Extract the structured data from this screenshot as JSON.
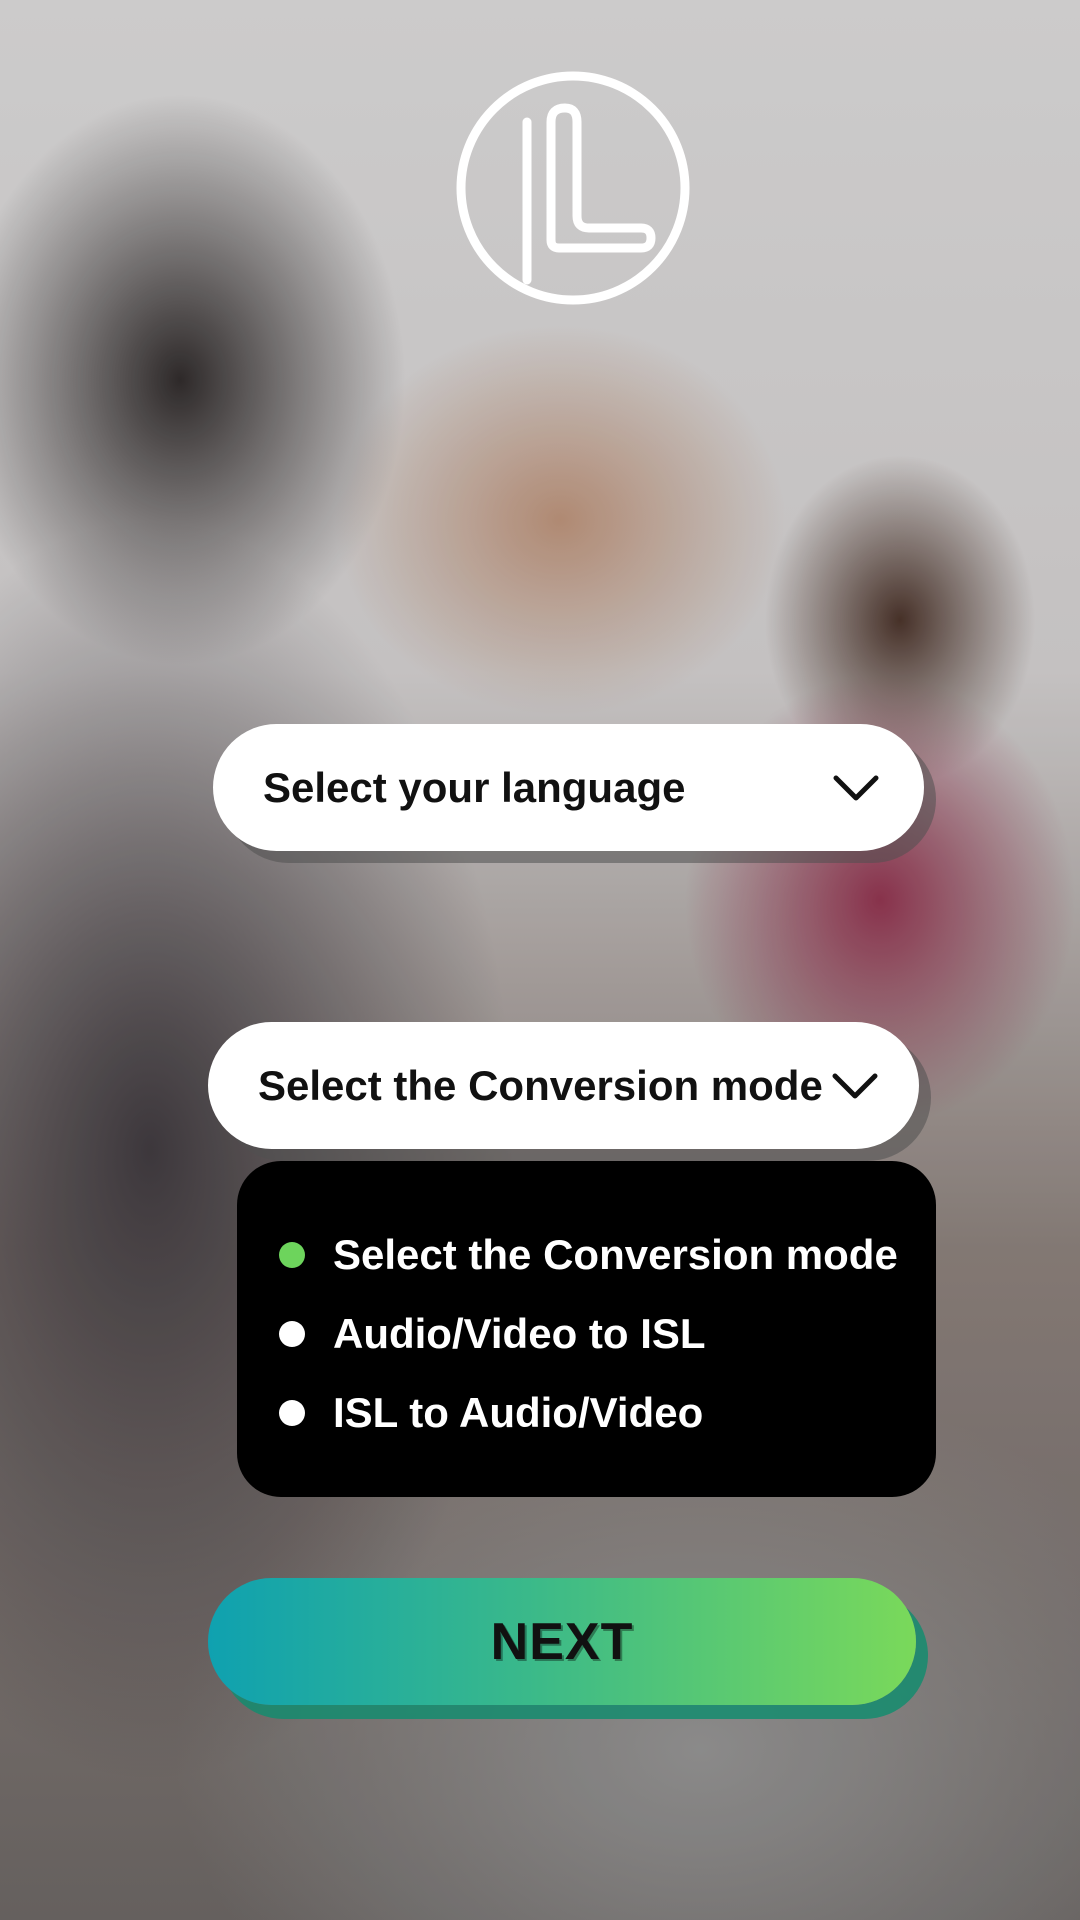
{
  "language_select": {
    "label": "Select your language",
    "icon": "chevron-down-icon"
  },
  "mode_select": {
    "label": "Select the Conversion mode",
    "icon": "chevron-down-icon"
  },
  "mode_options": [
    {
      "label": "Select the Conversion mode",
      "selected": true
    },
    {
      "label": "Audio/Video to ISL",
      "selected": false
    },
    {
      "label": "ISL to Audio/Video",
      "selected": false
    }
  ],
  "next_button": {
    "label": "NEXT"
  },
  "colors": {
    "selected_dot": "#6dd45c",
    "next_gradient_start": "#0fa1b0",
    "next_gradient_end": "#7ad95a"
  }
}
